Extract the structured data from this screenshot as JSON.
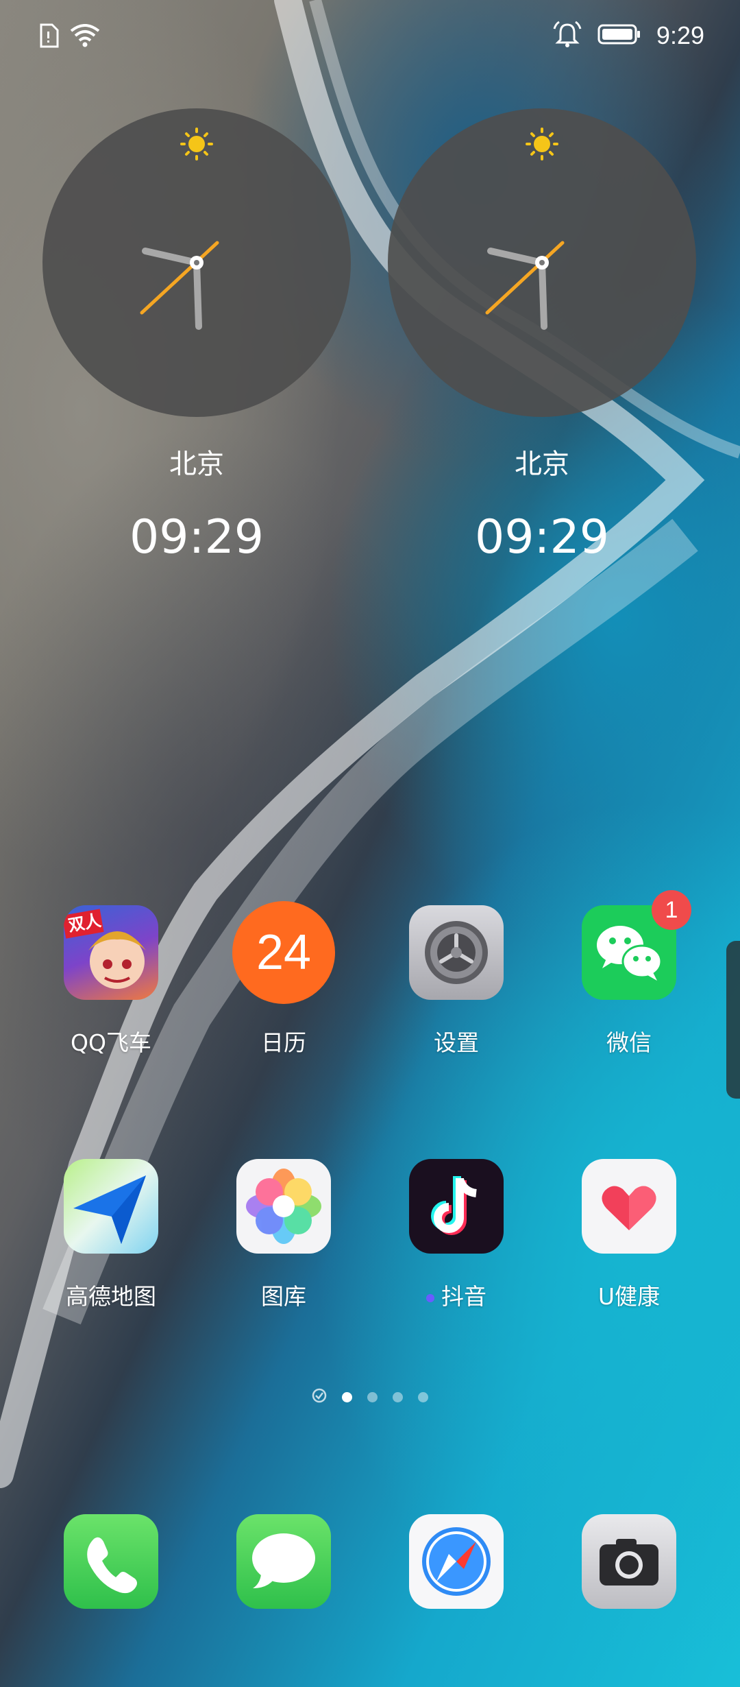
{
  "status_bar": {
    "time": "9:29",
    "icons": [
      "sim-icon",
      "wifi-icon",
      "alarm-bell-icon",
      "battery-icon"
    ]
  },
  "clocks": [
    {
      "city": "北京",
      "time": "09:29",
      "weather": "sun-icon"
    },
    {
      "city": "北京",
      "time": "09:29",
      "weather": "sun-icon"
    }
  ],
  "apps": {
    "row1": [
      {
        "label": "QQ飞车",
        "icon": "qq-speed-icon",
        "icon_text": "双人"
      },
      {
        "label": "日历",
        "icon": "calendar-icon",
        "icon_text": "24"
      },
      {
        "label": "设置",
        "icon": "settings-icon"
      },
      {
        "label": "微信",
        "icon": "wechat-icon",
        "badge": "1"
      }
    ],
    "row2": [
      {
        "label": "高德地图",
        "icon": "amap-icon"
      },
      {
        "label": "图库",
        "icon": "gallery-icon"
      },
      {
        "label": "抖音",
        "icon": "douyin-icon",
        "new_dot": true
      },
      {
        "label": "U健康",
        "icon": "health-icon"
      }
    ]
  },
  "pager": {
    "pages": 4,
    "current": 1
  },
  "dock": [
    "phone-icon",
    "messages-icon",
    "safari-icon",
    "camera-icon"
  ],
  "colors": {
    "calendar_orange": "#ff6a1f",
    "wechat_green": "#1ccc5a",
    "badge_red": "#f04b4b",
    "clock_hand_orange": "#f5a623"
  }
}
